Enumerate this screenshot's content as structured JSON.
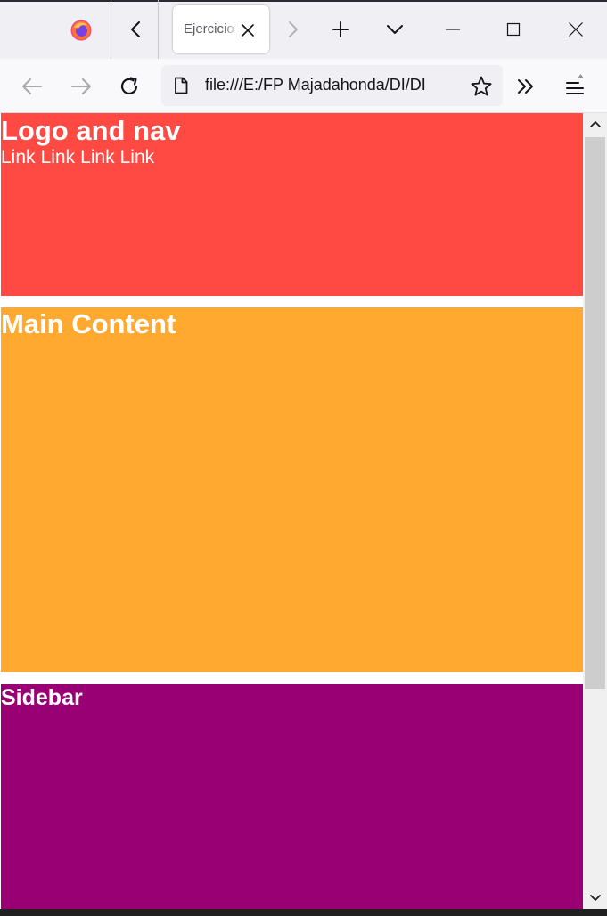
{
  "browser": {
    "tab": {
      "title": "Ejercicio"
    },
    "url": "file:///E:/FP Majadahonda/DI/DI"
  },
  "page": {
    "header": {
      "title": "Logo and nav",
      "links": [
        "Link",
        "Link",
        "Link",
        "Link"
      ]
    },
    "main": {
      "title": "Main Content"
    },
    "sidebar": {
      "title": "Sidebar"
    }
  },
  "colors": {
    "header": "#ff4a44",
    "main": "#ffa930",
    "sidebar": "#990074"
  },
  "icons": {
    "browser_logo": "firefox-logo",
    "tab_list_back": "chevron-left-icon",
    "tab_close": "close-icon",
    "tab_list_forward": "chevron-right-icon",
    "new_tab": "plus-icon",
    "list_all_tabs": "chevron-down-icon",
    "minimize": "minimize-icon",
    "maximize": "maximize-icon",
    "close_window": "close-icon",
    "back": "arrow-left-icon",
    "forward": "arrow-right-icon",
    "reload": "reload-icon",
    "page": "page-icon",
    "bookmark": "star-icon",
    "overflow": "double-chevron-icon",
    "menu": "menu-icon"
  }
}
